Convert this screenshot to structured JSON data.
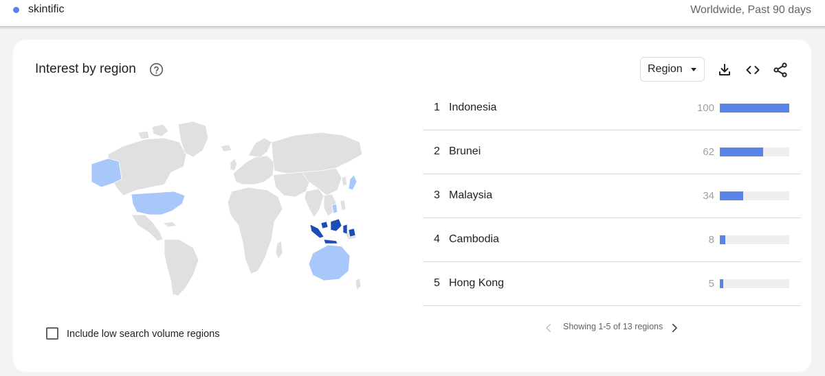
{
  "header": {
    "term": "skintific",
    "term_color": "#5884e7",
    "scope": "Worldwide, Past 90 days"
  },
  "card": {
    "title": "Interest by region",
    "help_icon": "help-circle-icon",
    "region_select": {
      "selected": "Region"
    },
    "tools": [
      "download-icon",
      "embed-code-icon",
      "share-icon"
    ]
  },
  "map": {
    "description_icon": "world-map",
    "colors": {
      "no_data": "#e0e0e0",
      "low": "#a8c7fa",
      "high": "#1a4db5"
    }
  },
  "low_volume_checkbox": {
    "label": "Include low search volume regions",
    "checked": false
  },
  "regions": [
    {
      "rank": "1",
      "name": "Indonesia",
      "value": 100
    },
    {
      "rank": "2",
      "name": "Brunei",
      "value": 62
    },
    {
      "rank": "3",
      "name": "Malaysia",
      "value": 34
    },
    {
      "rank": "4",
      "name": "Cambodia",
      "value": 8
    },
    {
      "rank": "5",
      "name": "Hong Kong",
      "value": 5
    }
  ],
  "bar_color": "#5884e7",
  "pagination": {
    "text": "Showing 1-5 of 13 regions"
  }
}
